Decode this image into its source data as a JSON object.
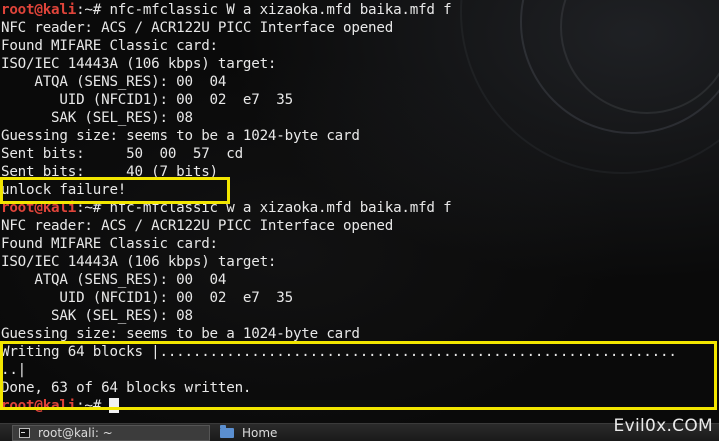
{
  "terminal": {
    "prompt_user": "root@kali",
    "prompt_path": ":~#",
    "commands": {
      "first": " nfc-mfclassic W a xizaoka.mfd baika.mfd f",
      "second": " nfc-mfclassic w a xizaoka.mfd baika.mfd f"
    },
    "output_block1": [
      "NFC reader: ACS / ACR122U PICC Interface opened",
      "Found MIFARE Classic card:",
      "ISO/IEC 14443A (106 kbps) target:",
      "    ATQA (SENS_RES): 00  04",
      "       UID (NFCID1): 00  02  e7  35",
      "      SAK (SEL_RES): 08",
      "Guessing size: seems to be a 1024-byte card",
      "Sent bits:     50  00  57  cd",
      "Sent bits:     40 (7 bits)",
      "unlock failure!"
    ],
    "output_block2": [
      "NFC reader: ACS / ACR122U PICC Interface opened",
      "Found MIFARE Classic card:",
      "ISO/IEC 14443A (106 kbps) target:",
      "    ATQA (SENS_RES): 00  04",
      "       UID (NFCID1): 00  02  e7  35",
      "      SAK (SEL_RES): 08",
      "Guessing size: seems to be a 1024-byte card",
      "Writing 64 blocks |..............................................................",
      "..|",
      "Done, 63 of 64 blocks written."
    ],
    "final_prompt_tail": " "
  },
  "taskbar": {
    "terminal_task": "root@kali: ~",
    "home_task": "Home"
  },
  "watermark": "Evil0x.COM",
  "colors": {
    "prompt": "#e0443a",
    "highlight_box": "#f2e600",
    "text": "#e8e8e8"
  }
}
